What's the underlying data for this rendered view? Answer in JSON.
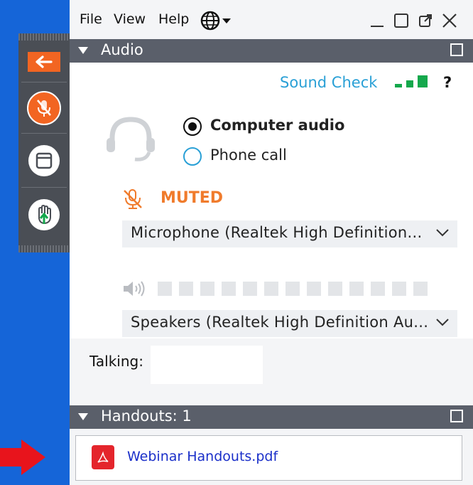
{
  "menu": {
    "file": "File",
    "view": "View",
    "help": "Help"
  },
  "audio": {
    "section_title": "Audio",
    "sound_check": "Sound Check",
    "help_glyph": "?",
    "computer_audio": "Computer audio",
    "phone_call": "Phone call",
    "muted_label": "MUTED",
    "microphone": "Microphone (Realtek High Definition...",
    "speakers": "Speakers (Realtek High Definition Au...",
    "talking_label": "Talking:"
  },
  "handouts": {
    "section_title": "Handouts: 1",
    "file_name": "Webinar Handouts.pdf"
  },
  "colors": {
    "background": "#1565d8",
    "toolbar": "#4a4e55",
    "accent_orange": "#f26522",
    "muted_orange": "#f07b2c",
    "link_blue": "#2aa0d6",
    "signal_green": "#14a84c",
    "section_bar": "#5a5f6a",
    "pdf_red": "#e4252c",
    "arrow_red": "#e8141c"
  },
  "icons": [
    "back-arrow-icon",
    "muted-mic-icon",
    "window-icon",
    "raise-hand-icon",
    "globe-icon",
    "headset-icon",
    "signal-bars-icon",
    "speaker-icon",
    "pdf-file-icon"
  ]
}
